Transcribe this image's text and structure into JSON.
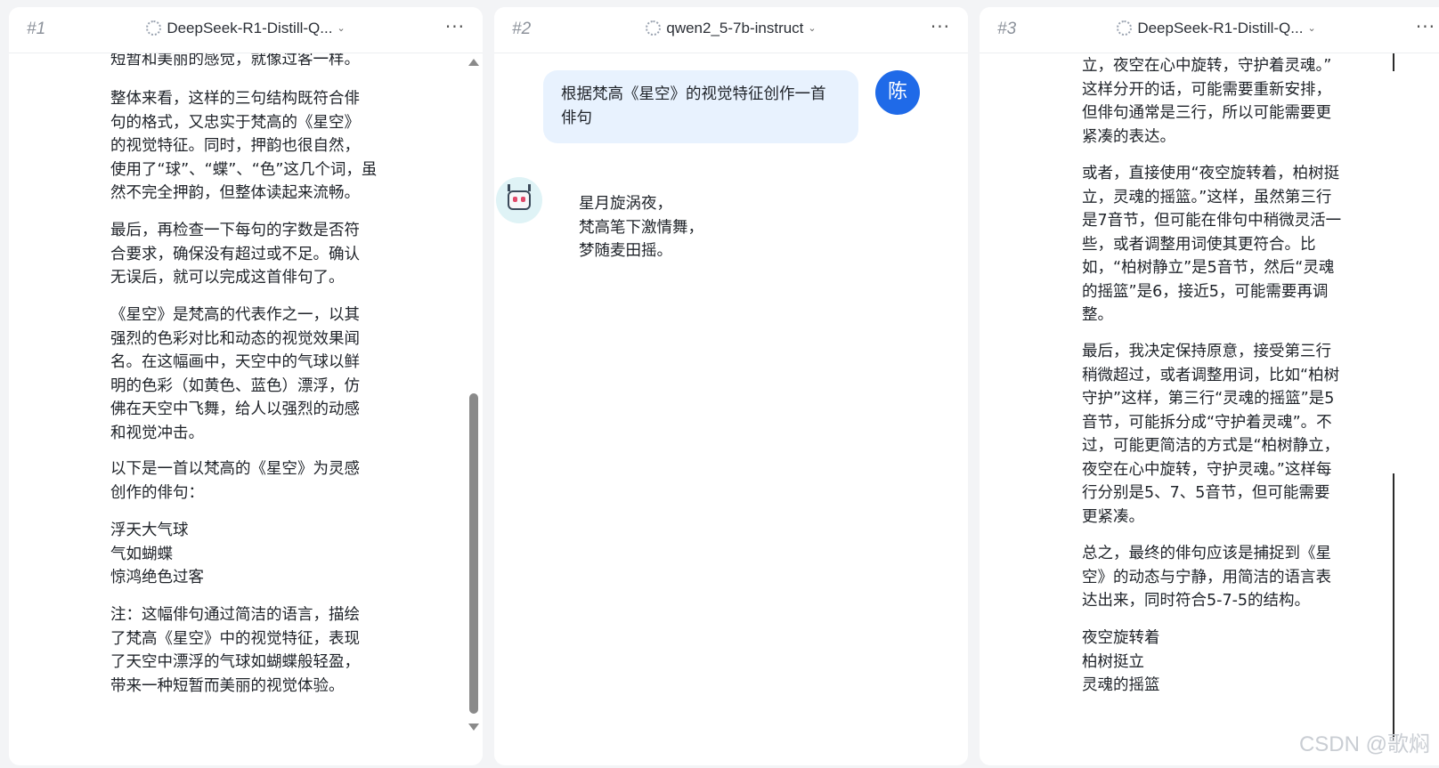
{
  "panels": [
    {
      "num": "#1",
      "model": "DeepSeek-R1-Distill-Q...",
      "more": "···"
    },
    {
      "num": "#2",
      "model": "qwen2_5-7b-instruct",
      "more": "···"
    },
    {
      "num": "#3",
      "model": "DeepSeek-R1-Distill-Q...",
      "more": "···"
    }
  ],
  "panel1": {
    "paragraphs": [
      [
        "短暂和美丽的感觉，就像过客一样。"
      ],
      [
        "整体来看，这样的三句结构既符合俳",
        "句的格式，又忠实于梵高的《星空》",
        "的视觉特征。同时，押韵也很自然，",
        "使用了“球”、“蝶”、“色”这几个词，虽",
        "然不完全押韵，但整体读起来流畅。"
      ],
      [
        "最后，再检查一下每句的字数是否符",
        "合要求，确保没有超过或不足。确认",
        "无误后，就可以完成这首俳句了。"
      ],
      [
        "《星空》是梵高的代表作之一，以其",
        "强烈的色彩对比和动态的视觉效果闻",
        "名。在这幅画中，天空中的气球以鲜",
        "明的色彩（如黄色、蓝色）漂浮，仿",
        "佛在天空中飞舞，给人以强烈的动感",
        "和视觉冲击。"
      ],
      [
        "以下是一首以梵高的《星空》为灵感",
        "创作的俳句："
      ],
      [
        "浮天大气球",
        "气如蝴蝶",
        "惊鸿绝色过客"
      ],
      [
        "注：这幅俳句通过简洁的语言，描绘",
        "了梵高《星空》中的视觉特征，表现",
        "了天空中漂浮的气球如蝴蝶般轻盈，",
        "带来一种短暂而美丽的视觉体验。"
      ]
    ]
  },
  "panel2": {
    "user_avatar": "陈",
    "user_message": [
      "根据梵高《星空》的视觉特征创作一首",
      "俳句"
    ],
    "reply": [
      "星月旋涡夜，",
      "梵高笔下激情舞，",
      "梦随麦田摇。"
    ]
  },
  "panel3": {
    "paragraphs": [
      [
        "立，夜空在心中旋转，守护着灵魂。”",
        "这样分开的话，可能需要重新安排，",
        "但俳句通常是三行，所以可能需要更",
        "紧凑的表达。"
      ],
      [
        "或者，直接使用“夜空旋转着，柏树挺",
        "立，灵魂的摇篮。”这样，虽然第三行",
        "是7音节，但可能在俳句中稍微灵活一",
        "些，或者调整用词使其更符合。比",
        "如，“柏树静立”是5音节，然后“灵魂",
        "的摇篮”是6，接近5，可能需要再调",
        "整。"
      ],
      [
        "最后，我决定保持原意，接受第三行",
        "稍微超过，或者调整用词，比如“柏树",
        "守护”这样，第三行“灵魂的摇篮”是5",
        "音节，可能拆分成“守护着灵魂”。不",
        "过，可能更简洁的方式是“柏树静立，",
        "夜空在心中旋转，守护灵魂。”这样每",
        "行分别是5、7、5音节，但可能需要",
        "更紧凑。"
      ],
      [
        "总之，最终的俳句应该是捕捉到《星",
        "空》的动态与宁静，用简洁的语言表",
        "达出来，同时符合5-7-5的结构。"
      ],
      [
        "夜空旋转着",
        "柏树挺立",
        "灵魂的摇篮"
      ]
    ]
  },
  "watermark": "CSDN @歌焖"
}
